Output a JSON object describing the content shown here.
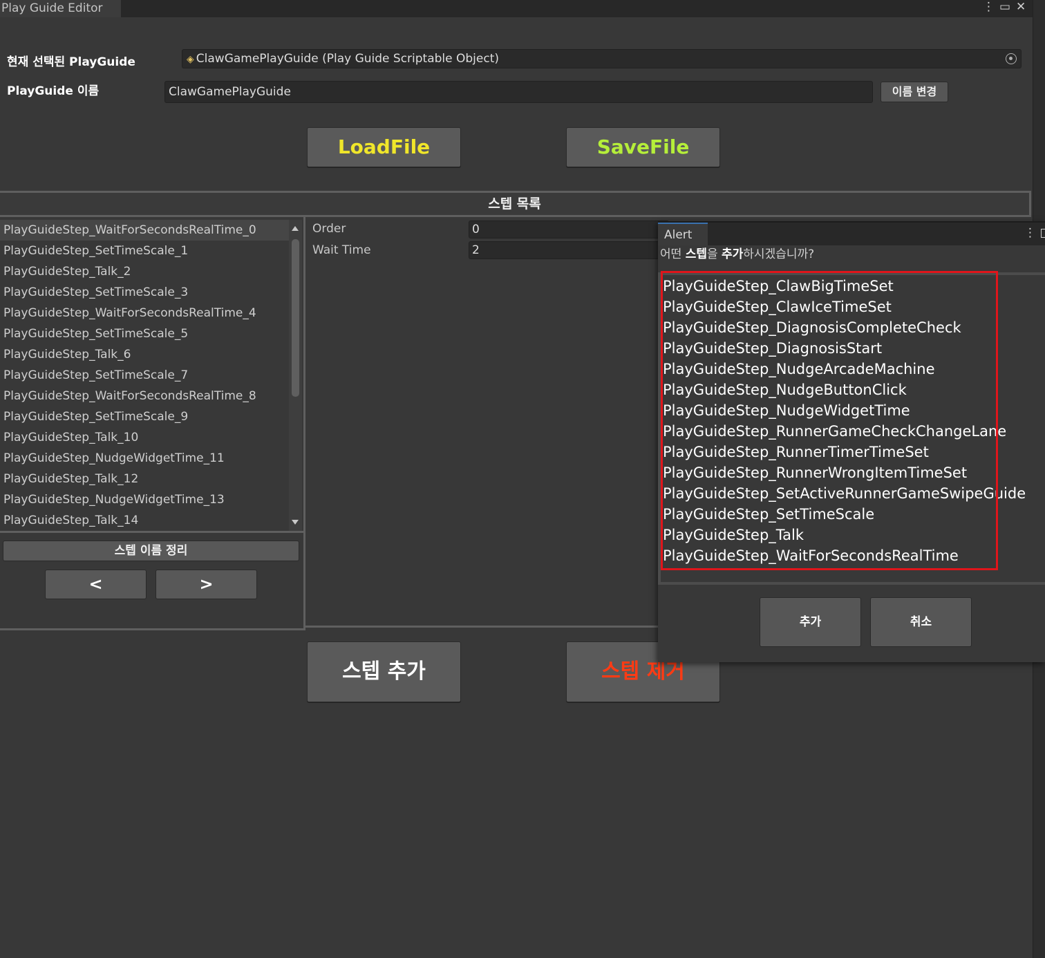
{
  "window": {
    "tab_title": "Play Guide Editor",
    "menu_icon": "⋮",
    "maximize_icon": "▭",
    "close_icon": "✕"
  },
  "header": {
    "selected_label": "현재 선택된 PlayGuide",
    "selected_value": "ClawGamePlayGuide (Play Guide Scriptable Object)",
    "name_label": "PlayGuide 이름",
    "name_value": "ClawGamePlayGuide",
    "rename_button": "이름 변경"
  },
  "file_buttons": {
    "load": "LoadFile",
    "save": "SaveFile",
    "load_color": "#f0e62a",
    "save_color": "#b5ee3a"
  },
  "steps": {
    "section_title": "스텝 목록",
    "items": [
      "PlayGuideStep_WaitForSecondsRealTime_0",
      "PlayGuideStep_SetTimeScale_1",
      "PlayGuideStep_Talk_2",
      "PlayGuideStep_SetTimeScale_3",
      "PlayGuideStep_WaitForSecondsRealTime_4",
      "PlayGuideStep_SetTimeScale_5",
      "PlayGuideStep_Talk_6",
      "PlayGuideStep_SetTimeScale_7",
      "PlayGuideStep_WaitForSecondsRealTime_8",
      "PlayGuideStep_SetTimeScale_9",
      "PlayGuideStep_Talk_10",
      "PlayGuideStep_NudgeWidgetTime_11",
      "PlayGuideStep_Talk_12",
      "PlayGuideStep_NudgeWidgetTime_13",
      "PlayGuideStep_Talk_14"
    ],
    "rename_all_button": "스텝 이름 정리",
    "prev_button": "<",
    "next_button": ">"
  },
  "properties": [
    {
      "label": "Order",
      "value": "0"
    },
    {
      "label": "Wait Time",
      "value": "2"
    }
  ],
  "bottom_buttons": {
    "add": "스텝 추가",
    "remove": "스텝 제거",
    "remove_color": "#ff3b14"
  },
  "alert": {
    "tab_title": "Alert",
    "question_prefix": "어떤 ",
    "question_bold1": "스텝",
    "question_mid": "을 ",
    "question_bold2": "추가",
    "question_suffix": "하시겠습니까?",
    "options": [
      "PlayGuideStep_ClawBigTimeSet",
      "PlayGuideStep_ClawIceTimeSet",
      "PlayGuideStep_DiagnosisCompleteCheck",
      "PlayGuideStep_DiagnosisStart",
      "PlayGuideStep_NudgeArcadeMachine",
      "PlayGuideStep_NudgeButtonClick",
      "PlayGuideStep_NudgeWidgetTime",
      "PlayGuideStep_RunnerGameCheckChangeLane",
      "PlayGuideStep_RunnerTimerTimeSet",
      "PlayGuideStep_RunnerWrongItemTimeSet",
      "PlayGuideStep_SetActiveRunnerGameSwipeGuide",
      "PlayGuideStep_SetTimeScale",
      "PlayGuideStep_Talk",
      "PlayGuideStep_WaitForSecondsRealTime"
    ],
    "confirm_button": "추가",
    "cancel_button": "취소",
    "highlight_color": "#e0151b"
  }
}
